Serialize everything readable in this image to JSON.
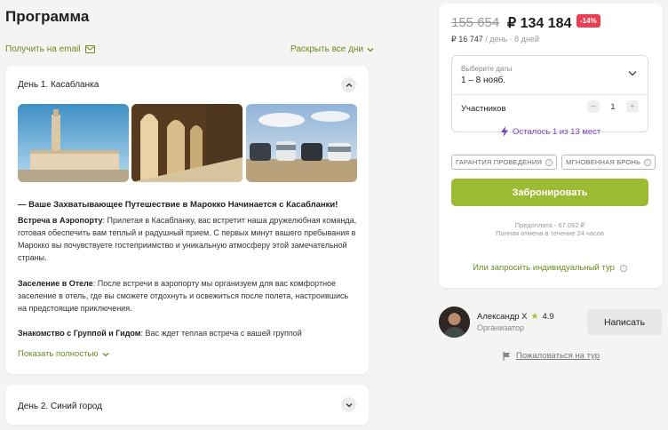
{
  "program": {
    "title": "Программа",
    "email_link": "Получить на email",
    "expand_link": "Раскрыть все дни"
  },
  "days": [
    {
      "title": "День 1. Касабланка",
      "trip_heading": "Ваше Захватывающее Путешествие в Марокко Начинается с Касабланки!",
      "paragraphs": [
        {
          "bold": "Встреча в Аэропорту",
          "text": ": Прилетая в Касабланку, вас встретит наша дружелюбная команда, готовая обеспечить вам теплый и радушный прием. С первых минут вашего пребывания в Марокко вы почувствуете гостеприимство и уникальную атмосферу этой замечательной страны."
        },
        {
          "bold": "Заселение в Отеле",
          "text": ": После встречи в аэропорту мы организуем для вас комфортное заселение в отель, где вы сможете отдохнуть и освежиться после полета, настроившись на предстоящие приключения."
        },
        {
          "bold": "Знакомство с Группой и Гидом",
          "text": ": Вас ждет теплая встреча с вашей группой"
        }
      ],
      "show_more": "Показать полностью"
    },
    {
      "title": "День 2. Синий город"
    }
  ],
  "booking": {
    "old_price": "155 654",
    "new_price": "₽ 134 184",
    "discount": "-14%",
    "per_day_price": "₽ 16 747",
    "per_day_suffix": " / день · 8 дней",
    "date_label": "Выберите даты",
    "date_value": "1 – 8 нояб.",
    "participants_label": "Участников",
    "participants_minus": "−",
    "participants_value": "1",
    "participants_plus": "+",
    "seats_left": "Осталось 1 из 13 мест",
    "badge_guarantee": "ГАРАНТИЯ ПРОВЕДЕНИЯ",
    "badge_instant": "МГНОВЕННАЯ БРОНЬ",
    "book_button": "Забронировать",
    "prepayment": "Предоплата - 67 092 ₽",
    "cancellation": "Полная отмена в течение 24 часов",
    "request_link": "Или запросить индивидуальный тур"
  },
  "organizer": {
    "name": "Александр Х",
    "rating": "4.9",
    "role": "Организатор",
    "write_button": "Написать",
    "report_link": "Пожаловаться на тур"
  },
  "colors": {
    "accent_green": "#9dbb32",
    "link_green": "#6d8a1f",
    "discount_red": "#e84055",
    "seats_purple": "#7b3fbf"
  }
}
